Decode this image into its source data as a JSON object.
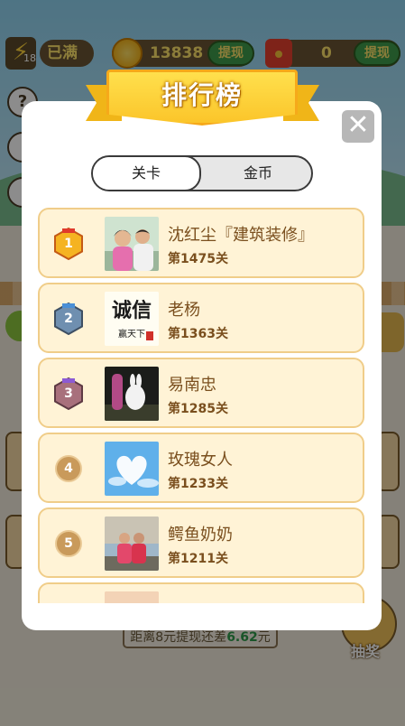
{
  "game": {
    "energy_level": "18",
    "energy_status": "已满",
    "coins": "13838",
    "withdraw_label": "提现",
    "redpacket_amount": "0",
    "draw_label": "抽奖",
    "progress_tip_prefix": "距离8元提现还差",
    "progress_tip_amount": "6.62",
    "progress_tip_suffix": "元"
  },
  "leaderboard": {
    "title": "排行榜",
    "close_icon": "close-icon",
    "tabs": [
      {
        "label": "关卡",
        "active": true
      },
      {
        "label": "金币",
        "active": false
      }
    ],
    "rows": [
      {
        "rank": "1",
        "name": "沈红尘『建筑装修』",
        "level": "第1475关",
        "badge_color": "#f5b321"
      },
      {
        "rank": "2",
        "name": "老杨",
        "level": "第1363关",
        "badge_color": "#6f8fb0"
      },
      {
        "rank": "3",
        "name": "易南忠",
        "level": "第1285关",
        "badge_color": "#a8707c"
      },
      {
        "rank": "4",
        "name": "玫瑰女人",
        "level": "第1233关"
      },
      {
        "rank": "5",
        "name": "鳄鱼奶奶",
        "level": "第1211关"
      }
    ],
    "avatar_texts": {
      "row2_big": "诚信",
      "row2_small": "赢天下"
    }
  }
}
